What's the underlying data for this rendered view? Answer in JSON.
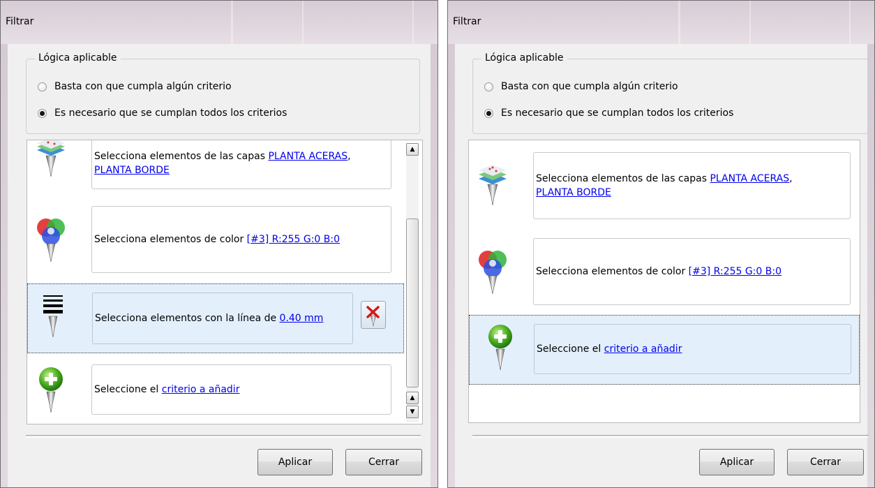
{
  "windows": [
    {
      "title": "Filtrar",
      "logic_group": {
        "legend": "Lógica aplicable",
        "options": [
          {
            "label": "Basta con que cumpla algún criterio",
            "checked": false
          },
          {
            "label": "Es necesario que se cumplan todos los criterios",
            "checked": true
          }
        ]
      },
      "criteria": [
        {
          "icon": "layers-filter-icon",
          "prefix": "Selecciona elementos de las capas ",
          "link1": "PLANTA ACERAS",
          "sep": ",",
          "link2": "PLANTA BORDE"
        },
        {
          "icon": "color-filter-icon",
          "prefix": "Selecciona elementos de color ",
          "link": "[#3] R:255 G:0 B:0"
        },
        {
          "icon": "line-width-filter-icon",
          "prefix": "Selecciona elementos con la línea de ",
          "link": "0.40 mm",
          "selected": true
        },
        {
          "icon": "add-filter-icon",
          "prefix": "Seleccione el ",
          "link": "criterio a añadir"
        }
      ],
      "buttons": {
        "apply": "Aplicar",
        "close": "Cerrar"
      }
    },
    {
      "title": "Filtrar",
      "logic_group": {
        "legend": "Lógica aplicable",
        "options": [
          {
            "label": "Basta con que cumpla algún criterio",
            "checked": false
          },
          {
            "label": "Es necesario que se cumplan todos los criterios",
            "checked": true
          }
        ]
      },
      "criteria": [
        {
          "icon": "layers-filter-icon",
          "prefix": "Selecciona elementos de las capas ",
          "link1": "PLANTA ACERAS",
          "sep": ",",
          "link2": "PLANTA BORDE"
        },
        {
          "icon": "color-filter-icon",
          "prefix": "Selecciona elementos de color ",
          "link": "[#3] R:255 G:0 B:0"
        },
        {
          "icon": "add-filter-icon",
          "prefix": "Seleccione el ",
          "link": "criterio a añadir",
          "selected": true
        }
      ],
      "buttons": {
        "apply": "Aplicar",
        "close": "Cerrar"
      }
    }
  ],
  "colors": {
    "link": "#0000ee",
    "selection": "#e3effb",
    "window": "#f0f0f0"
  }
}
